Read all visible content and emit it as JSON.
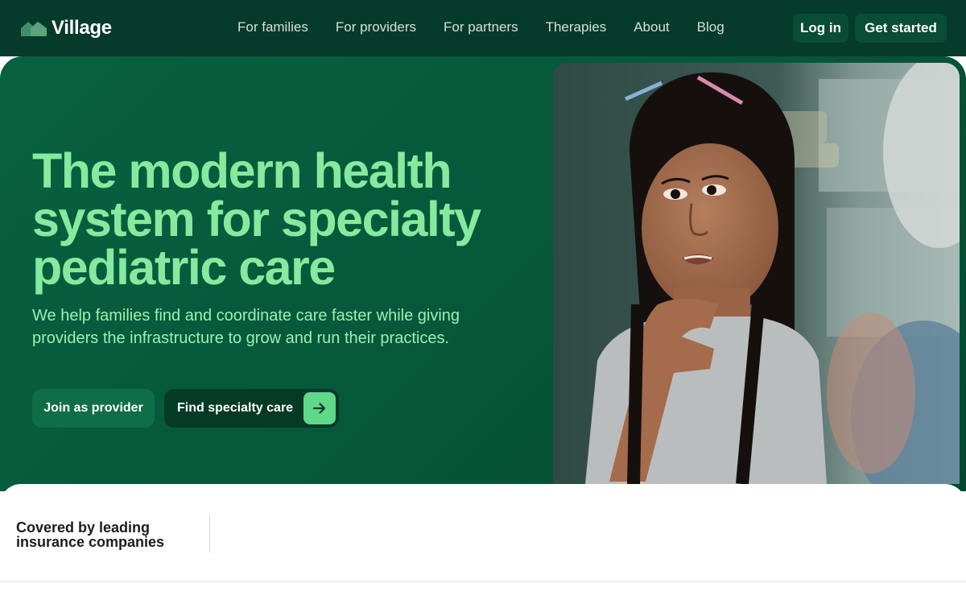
{
  "brand": {
    "name": "Village",
    "logo_icon": "house-logo-icon"
  },
  "nav": {
    "links": [
      "For families",
      "For providers",
      "For partners",
      "Therapies",
      "About",
      "Blog"
    ],
    "login_label": "Log in",
    "get_started_label": "Get started"
  },
  "hero": {
    "title": "The modern health system for specialty pediatric care",
    "subtitle": "We help families find and coordinate care faster while giving providers the infrastructure to grow and run their practices.",
    "join_provider_label": "Join as provider",
    "find_care_label": "Find specialty care",
    "find_care_icon": "arrow-right-icon"
  },
  "insurance": {
    "label": "Covered by leading insurance companies"
  },
  "colors": {
    "nav_bg": "#063a2a",
    "hero_bg": "#06573a",
    "accent_green": "#86ea9e",
    "arrow_button": "#5fd889"
  }
}
